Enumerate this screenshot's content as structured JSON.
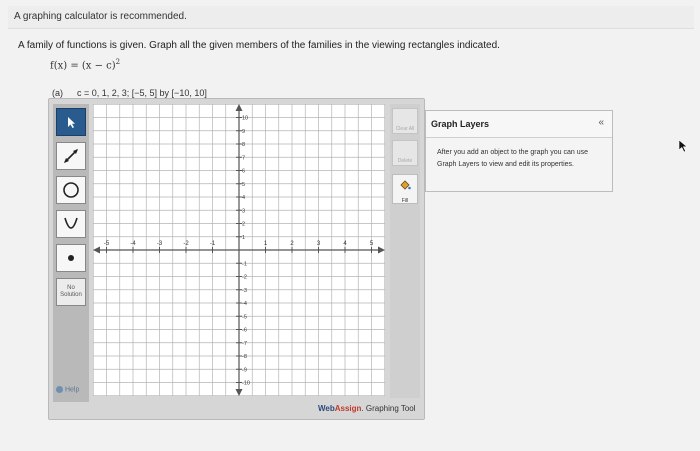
{
  "banner": "A graphing calculator is recommended.",
  "instructions": "A family of functions is given. Graph all the given members of the families in the viewing rectangles indicated.",
  "function": {
    "lhs": "f(x) = (x − c)",
    "exponent": "2"
  },
  "part": {
    "label": "(a)",
    "spec": "c = 0, 1, 2, 3; [−5, 5] by [−10, 10]"
  },
  "toolbar": {
    "tools": [
      "pointer",
      "line",
      "circle",
      "parabola",
      "point"
    ],
    "no_solution": [
      "No",
      "Solution"
    ],
    "help": "Help"
  },
  "graph": {
    "x_ticks": [
      "-5",
      "-4",
      "-3",
      "-2",
      "-1",
      "1",
      "2",
      "3",
      "4",
      "5"
    ],
    "y_ticks": [
      "10",
      "9",
      "8",
      "7",
      "6",
      "5",
      "4",
      "3",
      "2",
      "1",
      "-1",
      "-2",
      "-3",
      "-4",
      "-5",
      "-6",
      "-7",
      "-8",
      "-9",
      "-10"
    ]
  },
  "right_tools": {
    "clear_all": "Clear All",
    "delete": "Delete",
    "fill": "Fill"
  },
  "brand": {
    "web": "Web",
    "assign": "Assign",
    "suffix": ". Graphing Tool"
  },
  "layers": {
    "title": "Graph Layers",
    "collapse": "«",
    "body": "After you add an object to the graph you can use Graph Layers to view and edit its properties."
  },
  "colors": {
    "accent": "#2a5b8e",
    "axis": "#555555",
    "grid": "#b4b4b4"
  }
}
